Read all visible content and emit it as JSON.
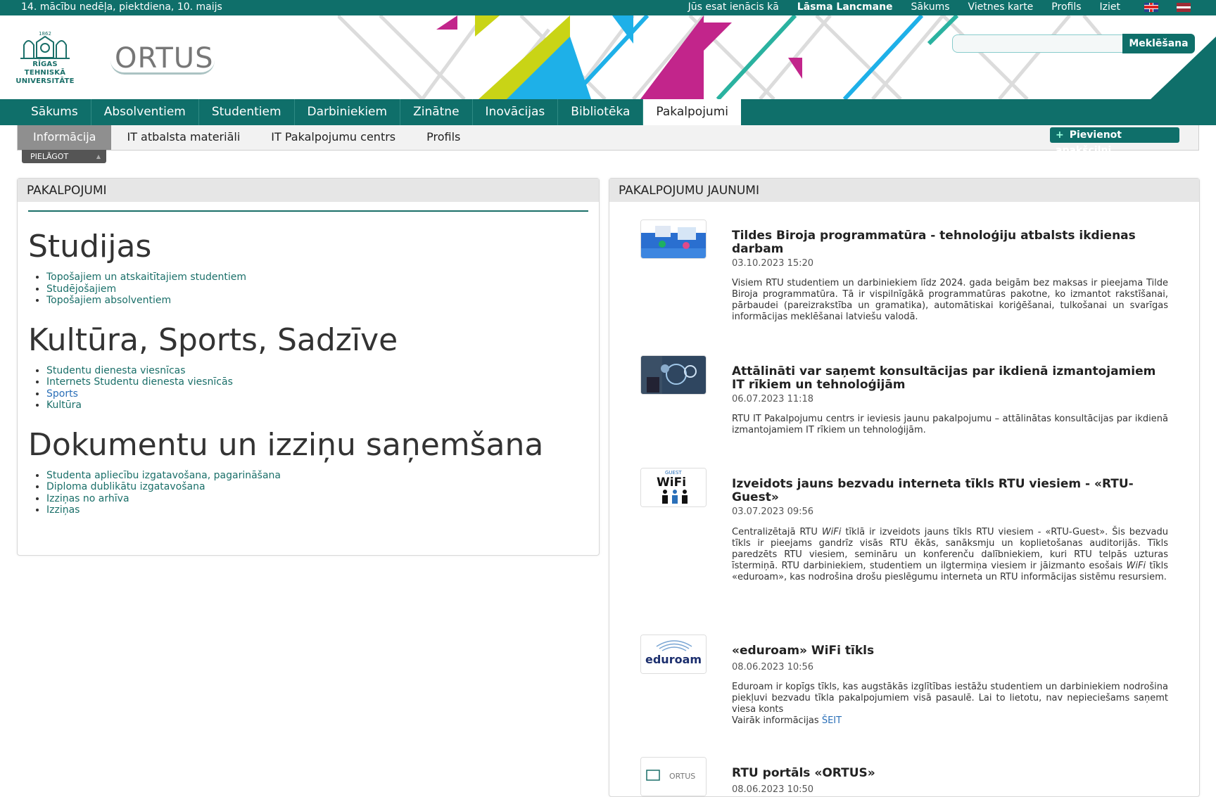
{
  "topbar": {
    "date": "14. mācību nedēļa, piektdiena, 10. maijs",
    "logged_in_label": "Jūs esat ienācis kā",
    "user_name": "Lāsma Lancmane",
    "links": [
      "Sākums",
      "Vietnes karte",
      "Profils",
      "Iziet"
    ]
  },
  "header": {
    "rtu_logo_year": "1862",
    "rtu_logo_line1": "RĪGAS TEHNISKĀ",
    "rtu_logo_line2": "UNIVERSITĀTE",
    "ortus_logo": "ORTUS",
    "search_button": "Meklēšana",
    "search_placeholder": ""
  },
  "mainnav": {
    "items": [
      "Sākums",
      "Absolventiem",
      "Studentiem",
      "Darbiniekiem",
      "Zinātne",
      "Inovācijas",
      "Bibliotēka",
      "Pakalpojumi"
    ],
    "active": "Pakalpojumi"
  },
  "subnav": {
    "items": [
      "Informācija",
      "IT atbalsta materiāli",
      "IT Pakalpojumu centrs",
      "Profils"
    ],
    "active": "Informācija",
    "add_button": "Pievienot apakšcilni",
    "customize": "PIELĀGOT"
  },
  "left_panel": {
    "title": "PAKALPOJUMI",
    "sections": [
      {
        "heading": "Studijas",
        "links": [
          "Topošajiem un atskaitītajiem studentiem",
          "Studējošajiem",
          "Topošajiem absolventiem"
        ]
      },
      {
        "heading": "Kultūra, Sports, Sadzīve",
        "links": [
          "Studentu dienesta viesnīcas",
          "Internets Studentu dienesta viesnīcās",
          "Sports",
          "Kultūra"
        ]
      },
      {
        "heading": "Dokumentu un izziņu saņemšana",
        "links": [
          "Studenta apliecību izgatavošana, pagarināšana",
          "Diploma dublikātu izgatavošana",
          "Izziņas no arhīva",
          "Izziņas"
        ]
      }
    ]
  },
  "right_panel": {
    "title": "PAKALPOJUMU JAUNUMI",
    "news": [
      {
        "title": "Tildes Biroja programmatūra - tehnoloģiju atbalsts ikdienas darbam",
        "date": "03.10.2023 15:20",
        "text": "Visiem RTU studentiem un darbiniekiem līdz 2024. gada beigām bez maksas ir pieejama Tilde Biroja programmatūra. Tā ir vispilnīgākā programmatūras pakotne, ko izmantot rakstīšanai, pārbaudei (pareizrakstība un gramatika), automātiskai koriģēšanai, tulkošanai un svarīgas informācijas meklēšanai latviešu valodā."
      },
      {
        "title": "Attālināti var saņemt konsultācijas par ikdienā izmantojamiem IT rīkiem un tehnoloģijām",
        "date": "06.07.2023 11:18",
        "text": "RTU IT Pakalpojumu centrs ir ieviesis jaunu pakalpojumu – attālinātas konsultācijas par ikdienā izmantojamiem IT rīkiem un tehnoloģijām."
      },
      {
        "title": "Izveidots jauns bezvadu interneta tīkls RTU viesiem - «RTU-Guest»",
        "date": "03.07.2023 09:56",
        "text_part1": "Centralizētajā RTU",
        "text_italic1": "WiFi",
        "text_part2": "tīklā ir izveidots jauns tīkls RTU viesiem - «RTU-Guest». Šis bezvadu tīkls ir pieejams gandrīz visās RTU ēkās, sanāksmju un koplietošanas auditorijās. Tīkls paredzēts RTU viesiem, semināru un konferenču dalībniekiem, kuri RTU telpās uzturas īstermiņā. RTU darbiniekiem, studentiem un ilgtermiņa viesiem ir jāizmanto esošais",
        "text_italic2": "WiFi",
        "text_part3": "tīkls «eduroam», kas nodrošina drošu pieslēgumu interneta un RTU informācijas sistēmu resursiem.",
        "thumb_label": "GUEST",
        "thumb_wifi": "WiFi"
      },
      {
        "title": "«eduroam» WiFi tīkls",
        "date": "08.06.2023 10:56",
        "text": "Eduroam ir kopīgs tīkls, kas augstākās izglītības iestāžu studentiem un darbiniekiem nodrošina piekļuvi bezvadu tīkla pakalpojumiem visā pasaulē. Lai to lietotu, nav nepieciešams saņemt viesa konts",
        "more_label": "Vairāk informācijas",
        "more_link": "ŠEIT",
        "thumb_text": "eduroam"
      },
      {
        "title": "RTU portāls «ORTUS»",
        "date": "08.06.2023 10:50",
        "thumb_text": "ORTUS"
      }
    ]
  },
  "colors": {
    "brand": "#0f6f6a",
    "link": "#1a6f69",
    "link_blue": "#2a6fb8",
    "panel_header": "#e6e6e6"
  }
}
